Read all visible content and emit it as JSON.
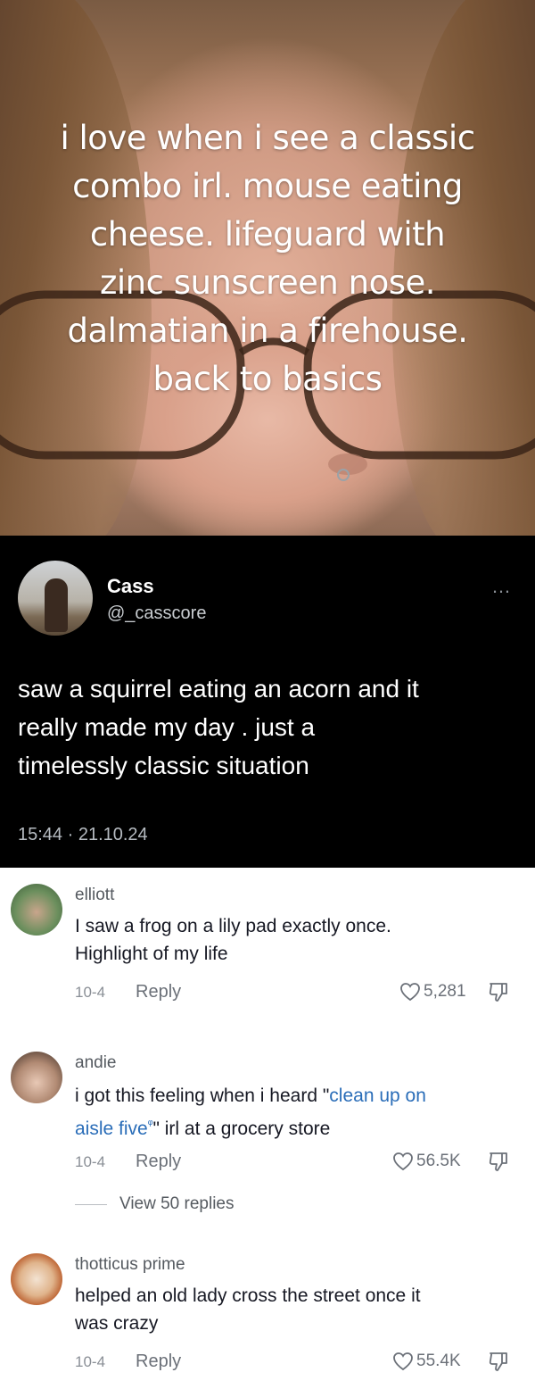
{
  "photo": {
    "caption_lines": [
      "i love when i see a classic",
      "combo irl. mouse eating",
      "cheese. lifeguard with",
      "zinc sunscreen nose.",
      "dalmatian in a firehouse.",
      "back to basics"
    ]
  },
  "tweet": {
    "name": "Cass",
    "handle": "@_casscore",
    "more": "…",
    "text_lines": [
      "saw a squirrel eating an acorn and it",
      "really made my day . just a",
      "timelessly classic situation"
    ],
    "timestamp": "15:44 · 21.10.24"
  },
  "comments": [
    {
      "user": "elliott",
      "text_lines": [
        "I saw a frog on a lily pad exactly once.",
        "Highlight of my life"
      ],
      "date": "10-4",
      "reply_label": "Reply",
      "likes": "5,281"
    },
    {
      "user": "andie",
      "text_prefix": "i got this feeling when i heard \"",
      "text_link_1": "clean up on",
      "text_link_2": "aisle five",
      "text_search_glyph": "ᵠ",
      "text_suffix": "\" irl at a grocery store",
      "date": "10-4",
      "reply_label": "Reply",
      "likes": "56.5K",
      "view_replies": "View 50 replies"
    },
    {
      "user": "thotticus prime",
      "text_lines": [
        "helped an old lady cross the street once it",
        "was crazy"
      ],
      "date": "10-4",
      "reply_label": "Reply",
      "likes": "55.4K"
    }
  ],
  "colors": {
    "tweet_bg": "#000000",
    "link": "#2a6db8",
    "muted": "#8a8f96"
  },
  "icons": {
    "like": "heart-outline-icon",
    "dislike": "thumbs-down-icon",
    "more": "more-horizontal-icon"
  }
}
